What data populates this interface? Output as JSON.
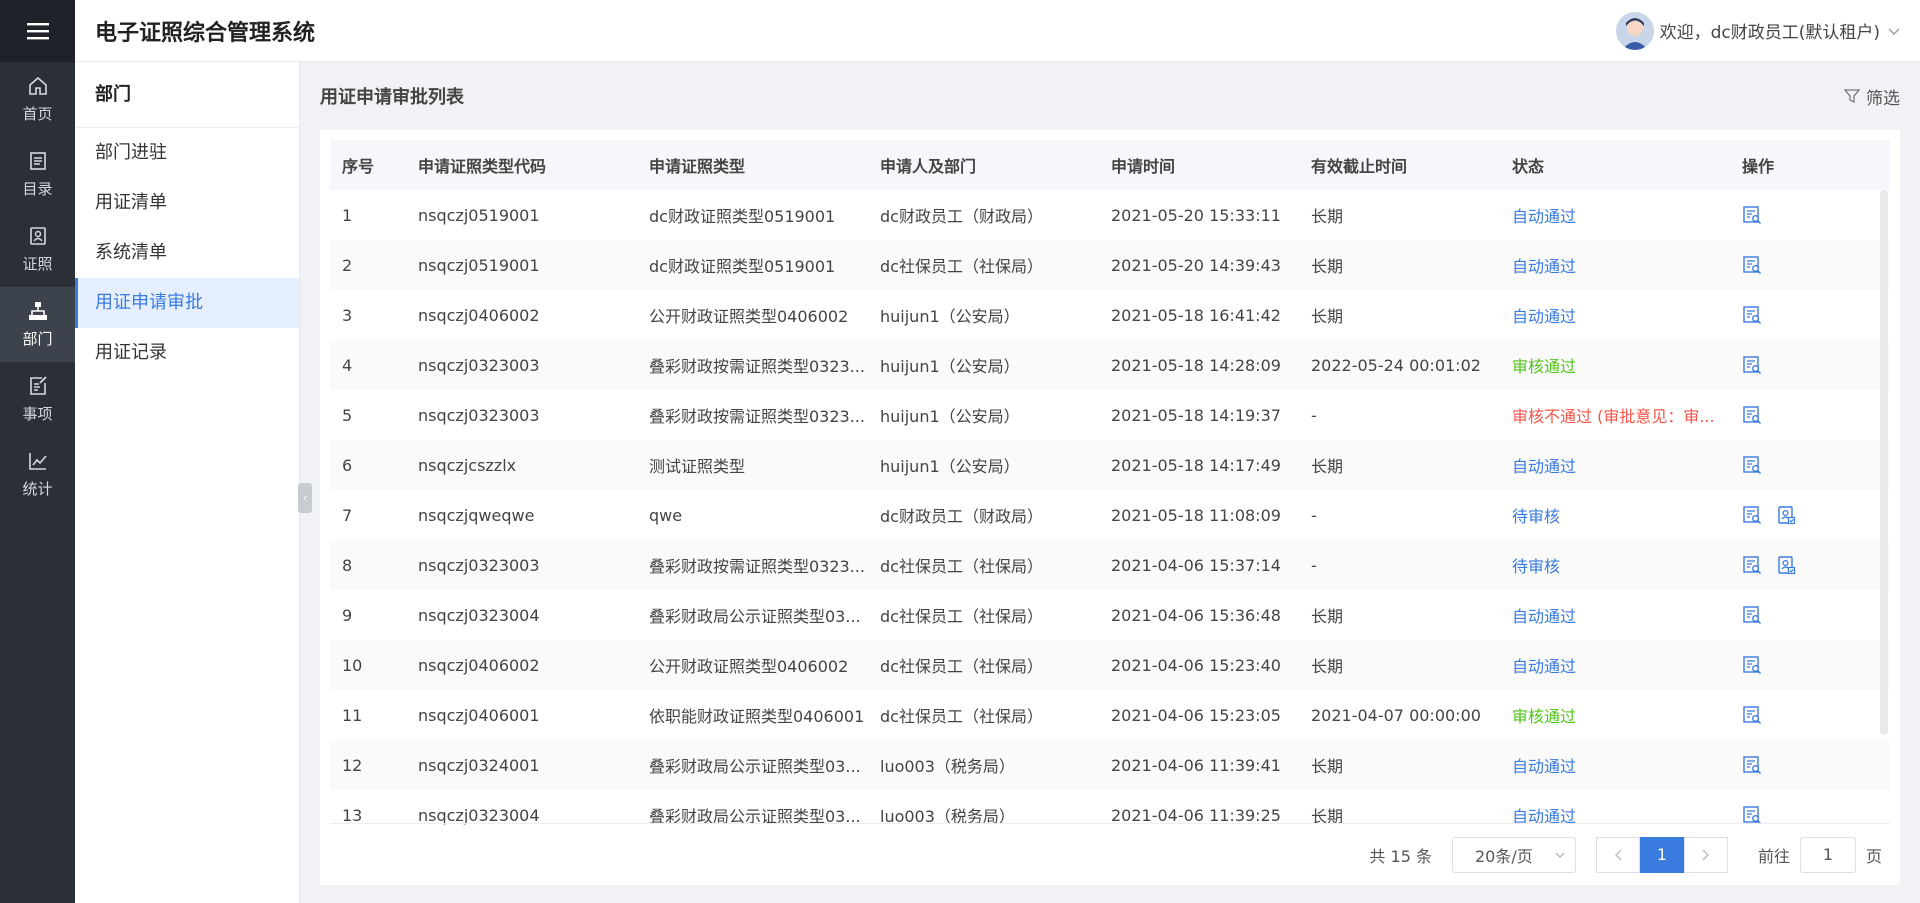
{
  "colors": {
    "accent": "#3a7be0",
    "nav_bg": "#2b2f36",
    "approved": "#52c41a",
    "rejected": "#f5554a"
  },
  "header": {
    "title": "电子证照综合管理系统",
    "user": "欢迎，dc财政员工(默认租户)"
  },
  "nav": [
    {
      "label": "首页",
      "icon": "home-icon"
    },
    {
      "label": "目录",
      "icon": "catalog-icon"
    },
    {
      "label": "证照",
      "icon": "license-icon"
    },
    {
      "label": "部门",
      "icon": "org-icon",
      "active": true
    },
    {
      "label": "事项",
      "icon": "task-icon"
    },
    {
      "label": "统计",
      "icon": "chart-icon"
    }
  ],
  "subnav": {
    "title": "部门",
    "items": [
      {
        "label": "部门进驻"
      },
      {
        "label": "用证清单"
      },
      {
        "label": "系统清单"
      },
      {
        "label": "用证申请审批",
        "active": true
      },
      {
        "label": "用证记录"
      }
    ]
  },
  "main": {
    "title": "用证申请审批列表",
    "filter_label": "筛选",
    "columns": [
      "序号",
      "申请证照类型代码",
      "申请证照类型",
      "申请人及部门",
      "申请时间",
      "有效截止时间",
      "状态",
      "操作"
    ],
    "rows": [
      {
        "no": "1",
        "code": "nsqczj0519001",
        "type": "dc财政证照类型0519001",
        "applicant": "dc财政员工（财政局）",
        "time": "2021-05-20 15:33:11",
        "expire": "长期",
        "status": "自动通过",
        "status_kind": "blue",
        "ops": 1
      },
      {
        "no": "2",
        "code": "nsqczj0519001",
        "type": "dc财政证照类型0519001",
        "applicant": "dc社保员工（社保局）",
        "time": "2021-05-20 14:39:43",
        "expire": "长期",
        "status": "自动通过",
        "status_kind": "blue",
        "ops": 1
      },
      {
        "no": "3",
        "code": "nsqczj0406002",
        "type": "公开财政证照类型0406002",
        "applicant": "huijun1（公安局）",
        "time": "2021-05-18 16:41:42",
        "expire": "长期",
        "status": "自动通过",
        "status_kind": "blue",
        "ops": 1
      },
      {
        "no": "4",
        "code": "nsqczj0323003",
        "type": "叠彩财政按需证照类型0323...",
        "applicant": "huijun1（公安局）",
        "time": "2021-05-18 14:28:09",
        "expire": "2022-05-24 00:01:02",
        "status": "审核通过",
        "status_kind": "green",
        "ops": 1
      },
      {
        "no": "5",
        "code": "nsqczj0323003",
        "type": "叠彩财政按需证照类型0323...",
        "applicant": "huijun1（公安局）",
        "time": "2021-05-18 14:19:37",
        "expire": "-",
        "status": "审核不通过 (审批意见：审...",
        "status_kind": "red",
        "ops": 1
      },
      {
        "no": "6",
        "code": "nsqczjcszzlx",
        "type": "测试证照类型",
        "applicant": "huijun1（公安局）",
        "time": "2021-05-18 14:17:49",
        "expire": "长期",
        "status": "自动通过",
        "status_kind": "blue",
        "ops": 1
      },
      {
        "no": "7",
        "code": "nsqczjqweqwe",
        "type": "qwe",
        "applicant": "dc财政员工（财政局）",
        "time": "2021-05-18 11:08:09",
        "expire": "-",
        "status": "待审核",
        "status_kind": "blue",
        "ops": 2
      },
      {
        "no": "8",
        "code": "nsqczj0323003",
        "type": "叠彩财政按需证照类型0323...",
        "applicant": "dc社保员工（社保局）",
        "time": "2021-04-06 15:37:14",
        "expire": "-",
        "status": "待审核",
        "status_kind": "blue",
        "ops": 2
      },
      {
        "no": "9",
        "code": "nsqczj0323004",
        "type": "叠彩财政局公示证照类型03...",
        "applicant": "dc社保员工（社保局）",
        "time": "2021-04-06 15:36:48",
        "expire": "长期",
        "status": "自动通过",
        "status_kind": "blue",
        "ops": 1
      },
      {
        "no": "10",
        "code": "nsqczj0406002",
        "type": "公开财政证照类型0406002",
        "applicant": "dc社保员工（社保局）",
        "time": "2021-04-06 15:23:40",
        "expire": "长期",
        "status": "自动通过",
        "status_kind": "blue",
        "ops": 1
      },
      {
        "no": "11",
        "code": "nsqczj0406001",
        "type": "依职能财政证照类型0406001",
        "applicant": "dc社保员工（社保局）",
        "time": "2021-04-06 15:23:05",
        "expire": "2021-04-07 00:00:00",
        "status": "审核通过",
        "status_kind": "green",
        "ops": 1
      },
      {
        "no": "12",
        "code": "nsqczj0324001",
        "type": "叠彩财政局公示证照类型03...",
        "applicant": "luo003（税务局）",
        "time": "2021-04-06 11:39:41",
        "expire": "长期",
        "status": "自动通过",
        "status_kind": "blue",
        "ops": 1
      },
      {
        "no": "13",
        "code": "nsqczj0323004",
        "type": "叠彩财政局公示证照类型03...",
        "applicant": "luo003（税务局）",
        "time": "2021-04-06 11:39:25",
        "expire": "长期",
        "status": "自动通过",
        "status_kind": "blue",
        "ops": 1
      }
    ]
  },
  "pagination": {
    "total": "共 15 条",
    "page_size": "20条/页",
    "current_page": "1",
    "goto_prefix": "前往",
    "goto_value": "1",
    "goto_suffix": "页"
  }
}
